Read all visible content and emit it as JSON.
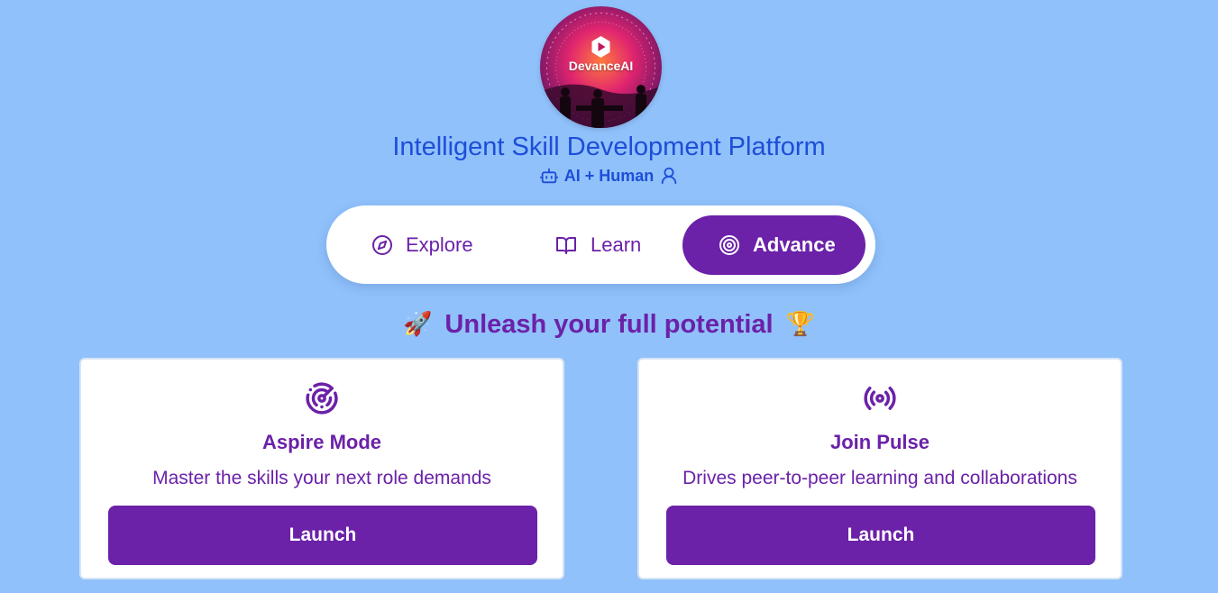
{
  "brand": {
    "logo_text": "DevanceAI"
  },
  "header": {
    "title": "Intelligent Skill Development Platform",
    "subtitle": "AI + Human"
  },
  "tabs": [
    {
      "label": "Explore",
      "icon": "compass-icon",
      "active": false
    },
    {
      "label": "Learn",
      "icon": "book-open-icon",
      "active": false
    },
    {
      "label": "Advance",
      "icon": "target-icon",
      "active": true
    }
  ],
  "tagline": {
    "text": "Unleash your full potential",
    "left_emoji": "🚀",
    "right_emoji": "🏆"
  },
  "cards": [
    {
      "title": "Aspire Mode",
      "description": "Master the skills your next role demands",
      "button_label": "Launch",
      "icon": "radar-icon"
    },
    {
      "title": "Join Pulse",
      "description": "Drives peer-to-peer learning and collaborations",
      "button_label": "Launch",
      "icon": "broadcast-icon"
    }
  ],
  "colors": {
    "background": "#90c1fb",
    "primary_purple": "#6b21a8",
    "title_blue": "#1d4ed8",
    "card_bg": "#ffffff"
  }
}
